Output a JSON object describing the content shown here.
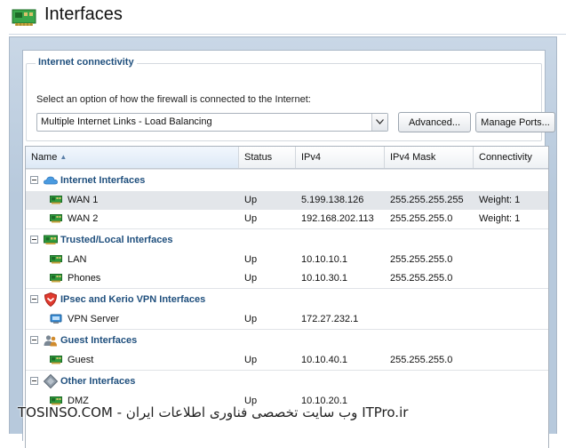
{
  "header": {
    "title": "Interfaces",
    "icon": "network-card-icon"
  },
  "connectivity": {
    "legend": "Internet connectivity",
    "description": "Select an option of how the firewall is connected to the Internet:",
    "mode_value": "Multiple Internet Links - Load Balancing",
    "advanced_label": "Advanced...",
    "manage_ports_label": "Manage Ports..."
  },
  "columns": [
    "Name",
    "Status",
    "IPv4",
    "IPv4 Mask",
    "Connectivity"
  ],
  "sort": {
    "column": "Name",
    "direction": "ascending"
  },
  "groups": [
    {
      "label": "Internet Interfaces",
      "icon": "cloud-icon",
      "rows": [
        {
          "name": "WAN 1",
          "status": "Up",
          "ipv4": "5.199.138.126",
          "mask": "255.255.255.255",
          "connectivity": "Weight: 1",
          "selected": true
        },
        {
          "name": "WAN 2",
          "status": "Up",
          "ipv4": "192.168.202.113",
          "mask": "255.255.255.0",
          "connectivity": "Weight: 1"
        }
      ]
    },
    {
      "label": "Trusted/Local Interfaces",
      "icon": "network-card-icon",
      "rows": [
        {
          "name": "LAN",
          "status": "Up",
          "ipv4": "10.10.10.1",
          "mask": "255.255.255.0",
          "connectivity": ""
        },
        {
          "name": "Phones",
          "status": "Up",
          "ipv4": "10.10.30.1",
          "mask": "255.255.255.0",
          "connectivity": ""
        }
      ]
    },
    {
      "label": "IPsec and Kerio VPN Interfaces",
      "icon": "shield-icon",
      "rows": [
        {
          "name": "VPN Server",
          "status": "Up",
          "ipv4": "172.27.232.1",
          "mask": "",
          "connectivity": ""
        }
      ]
    },
    {
      "label": "Guest Interfaces",
      "icon": "guest-users-icon",
      "rows": [
        {
          "name": "Guest",
          "status": "Up",
          "ipv4": "10.10.40.1",
          "mask": "255.255.255.0",
          "connectivity": ""
        }
      ]
    },
    {
      "label": "Other Interfaces",
      "icon": "diamond-icon",
      "rows": [
        {
          "name": "DMZ",
          "status": "Up",
          "ipv4": "10.10.20.1",
          "mask": "",
          "connectivity": ""
        }
      ]
    }
  ],
  "watermark": "TOSINSO.COM - وب سایت تخصصی فناوری اطلاعات ایران ITPro.ir",
  "colors": {
    "group_label": "#1f4f7d",
    "panel_frame": "#b7c9dc",
    "selected_row": "#e3e6ea",
    "nic_green": "#2e9b3c"
  }
}
